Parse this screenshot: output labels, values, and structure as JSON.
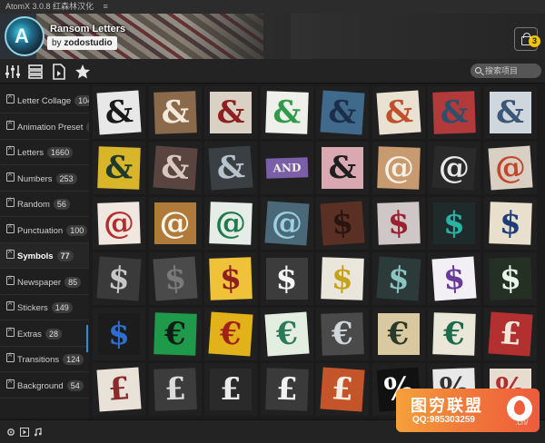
{
  "window": {
    "title": "AtomX 3.0.8 红森林汉化",
    "menu_glyph": "≡"
  },
  "header": {
    "pack_title": "Ransom Letters",
    "author_prefix": "by ",
    "author_name": "zodostudio",
    "cart_count": "3",
    "logo_glyph": "A"
  },
  "toolbar": {
    "icons": [
      "sliders-icon",
      "list-icon",
      "file-import-icon",
      "star-icon"
    ],
    "search_placeholder": "搜索项目"
  },
  "sidebar": {
    "items": [
      {
        "label": "Letter Collage",
        "count": "104",
        "active": false
      },
      {
        "label": "Animation Preset",
        "count": "1",
        "active": false
      },
      {
        "label": "Letters",
        "count": "1660",
        "active": false
      },
      {
        "label": "Numbers",
        "count": "253",
        "active": false
      },
      {
        "label": "Random",
        "count": "56",
        "active": false
      },
      {
        "label": "Punctuation",
        "count": "100",
        "active": false
      },
      {
        "label": "Symbols",
        "count": "77",
        "active": true
      },
      {
        "label": "Newspaper",
        "count": "85",
        "active": false
      },
      {
        "label": "Stickers",
        "count": "149",
        "active": false
      },
      {
        "label": "Extras",
        "count": "28",
        "active": false
      },
      {
        "label": "Transitions",
        "count": "124",
        "active": false
      },
      {
        "label": "Background",
        "count": "54",
        "active": false
      }
    ]
  },
  "grid": {
    "rows": [
      [
        {
          "ch": "&",
          "bg": "#e8e8e8",
          "fg": "#1a1a1a"
        },
        {
          "ch": "&",
          "bg": "#8a6a4a",
          "fg": "#f2ead8"
        },
        {
          "ch": "&",
          "bg": "#d9d2c4",
          "fg": "#8e1f1f"
        },
        {
          "ch": "&",
          "bg": "#f0f0ea",
          "fg": "#2e9a4a"
        },
        {
          "ch": "&",
          "bg": "#3f6a8c",
          "fg": "#1c2e4a"
        },
        {
          "ch": "&",
          "bg": "#e9e2d2",
          "fg": "#c0502a"
        },
        {
          "ch": "&",
          "bg": "#b33a3a",
          "fg": "#2d4f6e"
        },
        {
          "ch": "&",
          "bg": "#cfd6dc",
          "fg": "#3b5676"
        }
      ],
      [
        {
          "ch": "&",
          "bg": "#d9b52a",
          "fg": "#1d3a2a"
        },
        {
          "ch": "&",
          "bg": "#5a4440",
          "fg": "#d8c8c0"
        },
        {
          "ch": "&",
          "bg": "#3a3f44",
          "fg": "#b7c2cc"
        },
        {
          "ch": "AND",
          "bg": "#7a5ea8",
          "fg": "#f4f0e0"
        },
        {
          "ch": "&",
          "bg": "#d9a8b0",
          "fg": "#1e1e1e"
        },
        {
          "ch": "@",
          "bg": "#c89a70",
          "fg": "#f6efe2"
        },
        {
          "ch": "@",
          "bg": "#2a2a2a",
          "fg": "#e8e8e8"
        },
        {
          "ch": "@",
          "bg": "#d9cfc3",
          "fg": "#c2462a"
        }
      ],
      [
        {
          "ch": "@",
          "bg": "#f0e8e0",
          "fg": "#b22d2d"
        },
        {
          "ch": "@",
          "bg": "#b07a3a",
          "fg": "#fbf6ea"
        },
        {
          "ch": "@",
          "bg": "#e6ede8",
          "fg": "#1f7a4a"
        },
        {
          "ch": "@",
          "bg": "#4a6878",
          "fg": "#9ad0e0"
        },
        {
          "ch": "$",
          "bg": "#5a3024",
          "fg": "#2a140e"
        },
        {
          "ch": "$",
          "bg": "#cfc7c7",
          "fg": "#9a1f2f"
        },
        {
          "ch": "$",
          "bg": "#1f2a2a",
          "fg": "#25b4a6"
        },
        {
          "ch": "$",
          "bg": "#e8dfcc",
          "fg": "#1d3d7a"
        }
      ],
      [
        {
          "ch": "$",
          "bg": "#3a3a3a",
          "fg": "#c9c9c9"
        },
        {
          "ch": "$",
          "bg": "#4a4a4a",
          "fg": "#7a7a7a"
        },
        {
          "ch": "$",
          "bg": "#efc23a",
          "fg": "#8e1f1f"
        },
        {
          "ch": "$",
          "bg": "#3c3c3c",
          "fg": "#f4f4f4"
        },
        {
          "ch": "$",
          "bg": "#eae6dc",
          "fg": "#c4a21a"
        },
        {
          "ch": "$",
          "bg": "#2c3a3a",
          "fg": "#8ac6c6"
        },
        {
          "ch": "$",
          "bg": "#f2f0f4",
          "fg": "#6a3a9a"
        },
        {
          "ch": "$",
          "bg": "#253025",
          "fg": "#e8f6ea"
        }
      ],
      [
        {
          "ch": "$",
          "bg": "#1c1c1c",
          "fg": "#2d6ed0"
        },
        {
          "ch": "€",
          "bg": "#1f9a4a",
          "fg": "#0e1e14"
        },
        {
          "ch": "€",
          "bg": "#e2b21a",
          "fg": "#a2221a"
        },
        {
          "ch": "€",
          "bg": "#e4eee0",
          "fg": "#2a7a5a"
        },
        {
          "ch": "€",
          "bg": "#4a4a4a",
          "fg": "#cfd6dc"
        },
        {
          "ch": "€",
          "bg": "#d9c9a0",
          "fg": "#2a3a2a"
        },
        {
          "ch": "€",
          "bg": "#eae6d8",
          "fg": "#1e6a4a"
        },
        {
          "ch": "£",
          "bg": "#b23030",
          "fg": "#f2e8da"
        }
      ],
      [
        {
          "ch": "£",
          "bg": "#e8e2d8",
          "fg": "#8a2a2a"
        },
        {
          "ch": "£",
          "bg": "#3c3c3c",
          "fg": "#dcdcdc"
        },
        {
          "ch": "£",
          "bg": "#2a2a2a",
          "fg": "#eaeaea"
        },
        {
          "ch": "£",
          "bg": "#3a3a3a",
          "fg": "#f2f2f2"
        },
        {
          "ch": "£",
          "bg": "#c4552a",
          "fg": "#f4eee4"
        },
        {
          "ch": "%",
          "bg": "#111111",
          "fg": "#ffffff"
        },
        {
          "ch": "%",
          "bg": "#e8e8e8",
          "fg": "#333333"
        },
        {
          "ch": "%",
          "bg": "#e6dcd0",
          "fg": "#b22d2d"
        }
      ]
    ]
  },
  "bottombar": {
    "icons": [
      "settings-icon",
      "play-icon",
      "music-icon"
    ]
  },
  "watermark": {
    "title": "图穷联盟",
    "qq": "QQ:985303259",
    "domain_fragment": ".cn/"
  }
}
